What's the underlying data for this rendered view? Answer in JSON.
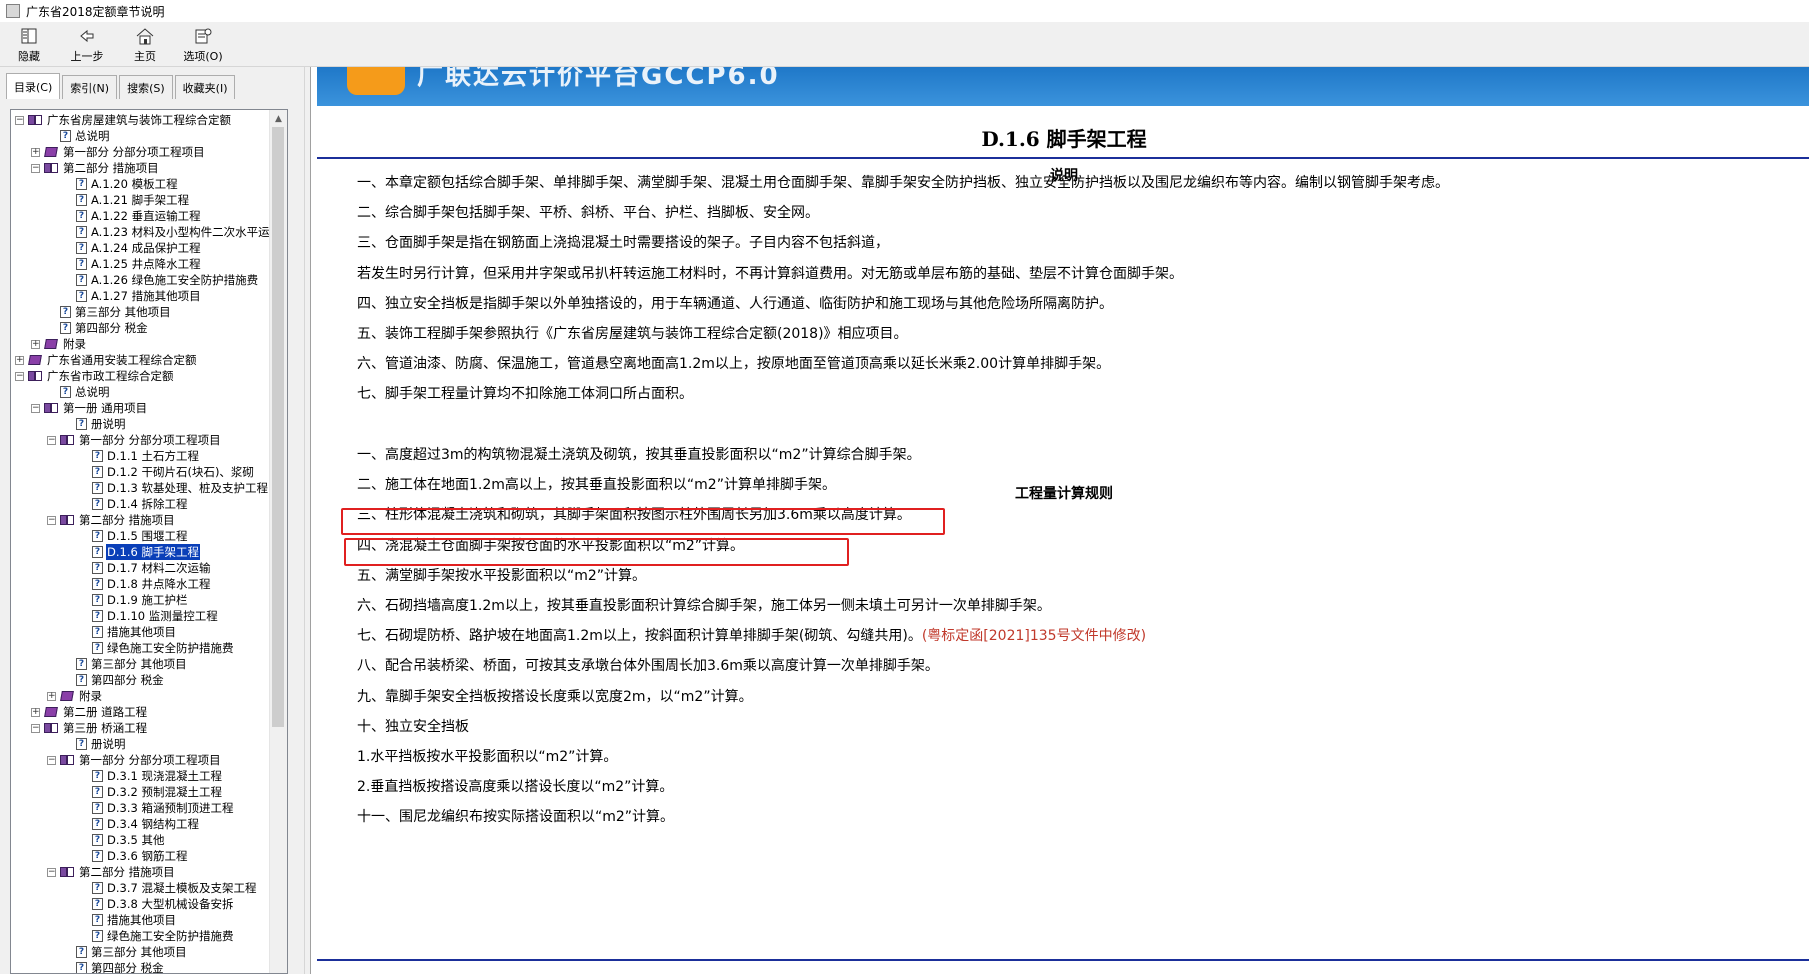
{
  "window": {
    "title": "广东省2018定额章节说明"
  },
  "toolbar": {
    "hide_label": "隐藏",
    "back_label": "上一步",
    "home_label": "主页",
    "options_label": "选项(O)"
  },
  "tabs": {
    "contents": "目录(C)",
    "index": "索引(N)",
    "search": "搜索(S)",
    "favorites": "收藏夹(I)"
  },
  "tree": {
    "items": [
      {
        "label": "广东省房屋建筑与装饰工程综合定额"
      },
      {
        "label": "总说明"
      },
      {
        "label": "第一部分 分部分项工程项目"
      },
      {
        "label": "第二部分 措施项目"
      },
      {
        "label": "A.1.20 模板工程"
      },
      {
        "label": "A.1.21 脚手架工程"
      },
      {
        "label": "A.1.22 垂直运输工程"
      },
      {
        "label": "A.1.23 材料及小型构件二次水平运"
      },
      {
        "label": "A.1.24 成品保护工程"
      },
      {
        "label": "A.1.25 井点降水工程"
      },
      {
        "label": "A.1.26 绿色施工安全防护措施费"
      },
      {
        "label": "A.1.27 措施其他项目"
      },
      {
        "label": "第三部分 其他项目"
      },
      {
        "label": "第四部分 税金"
      },
      {
        "label": "附录"
      },
      {
        "label": "广东省通用安装工程综合定额"
      },
      {
        "label": "广东省市政工程综合定额"
      },
      {
        "label": "总说明"
      },
      {
        "label": "第一册 通用项目"
      },
      {
        "label": "册说明"
      },
      {
        "label": "第一部分 分部分项工程项目"
      },
      {
        "label": "D.1.1 土石方工程"
      },
      {
        "label": "D.1.2 干砌片石(块石)、浆砌"
      },
      {
        "label": "D.1.3 软基处理、桩及支护工程"
      },
      {
        "label": "D.1.4 拆除工程"
      },
      {
        "label": "第二部分 措施项目"
      },
      {
        "label": "D.1.5 围堰工程"
      },
      {
        "label": "D.1.6 脚手架工程"
      },
      {
        "label": "D.1.7 材料二次运输"
      },
      {
        "label": "D.1.8 井点降水工程"
      },
      {
        "label": "D.1.9 施工护栏"
      },
      {
        "label": "D.1.10 监测量控工程"
      },
      {
        "label": "措施其他项目"
      },
      {
        "label": "绿色施工安全防护措施费"
      },
      {
        "label": "第三部分 其他项目"
      },
      {
        "label": "第四部分 税金"
      },
      {
        "label": "附录"
      },
      {
        "label": "第二册 道路工程"
      },
      {
        "label": "第三册 桥涵工程"
      },
      {
        "label": "册说明"
      },
      {
        "label": "第一部分 分部分项工程项目"
      },
      {
        "label": "D.3.1 现浇混凝土工程"
      },
      {
        "label": "D.3.2 预制混凝土工程"
      },
      {
        "label": "D.3.3 箱涵预制顶进工程"
      },
      {
        "label": "D.3.4 钢结构工程"
      },
      {
        "label": "D.3.5 其他"
      },
      {
        "label": "D.3.6 钢筋工程"
      },
      {
        "label": "第二部分 措施项目"
      },
      {
        "label": "D.3.7 混凝土模板及支架工程"
      },
      {
        "label": "D.3.8 大型机械设备安拆"
      },
      {
        "label": "措施其他项目"
      },
      {
        "label": "绿色施工安全防护措施费"
      },
      {
        "label": "第三部分 其他项目"
      },
      {
        "label": "第四部分 税金"
      }
    ]
  },
  "banner": {
    "text": "广联达云计价平台GCCP6.0"
  },
  "doc": {
    "title": "D.1.6 脚手架工程",
    "section1": "说明",
    "lines1": [
      "一、本章定额包括综合脚手架、单排脚手架、满堂脚手架、混凝土用仓面脚手架、靠脚手架安全防护挡板、独立安全防护挡板以及围尼龙编织布等内容。编制以钢管脚手架考虑。",
      "二、综合脚手架包括脚手架、平桥、斜桥、平台、护栏、挡脚板、安全网。",
      "三、仓面脚手架是指在钢筋面上浇捣混凝土时需要搭设的架子。子目内容不包括斜道，",
      "若发生时另行计算，但采用井字架或吊扒杆转运施工材料时，不再计算斜道费用。对无筋或单层布筋的基础、垫层不计算仓面脚手架。",
      "四、独立安全挡板是指脚手架以外单独搭设的，用于车辆通道、人行通道、临街防护和施工现场与其他危险场所隔离防护。",
      "五、装饰工程脚手架参照执行《广东省房屋建筑与装饰工程综合定额(2018)》相应项目。",
      "六、管道油漆、防腐、保温施工，管道悬空离地面高1.2m以上，按原地面至管道顶高乘以延长米乘2.00计算单排脚手架。",
      "七、脚手架工程量计算均不扣除施工体洞口所占面积。"
    ],
    "section2": "工程量计算规则",
    "lines2": [
      "一、高度超过3m的构筑物混凝土浇筑及砌筑，按其垂直投影面积以“m2”计算综合脚手架。",
      "二、施工体在地面1.2m高以上，按其垂直投影面积以“m2”计算单排脚手架。",
      "三、柱形体混凝土浇筑和砌筑，其脚手架面积按图示柱外围周长另加3.6m乘以高度计算。",
      "四、浇混凝土仓面脚手架按仓面的水平投影面积以“m2”计算。",
      "五、满堂脚手架按水平投影面积以“m2”计算。",
      "六、石砌挡墙高度1.2m以上，按其垂直投影面积计算综合脚手架，施工体另一侧未填土可另计一次单排脚手架。",
      "七、石砌堤防桥、路护坡在地面高1.2m以上，按斜面积计算单排脚手架(砌筑、勾缝共用)。",
      "八、配合吊装桥梁、桥面，可按其支承墩台体外围周长加3.6m乘以高度计算一次单排脚手架。",
      "九、靠脚手架安全挡板按搭设长度乘以宽度2m，以“m2”计算。",
      "十、独立安全挡板",
      "1.水平挡板按水平投影面积以“m2”计算。",
      "2.垂直挡板按搭设高度乘以搭设长度以“m2”计算。",
      "十一、围尼龙编织布按实际搭设面积以“m2”计算。"
    ],
    "note_red": "(粤标定函[2021]135号文件中修改)"
  },
  "colors": {
    "highlight_box": "#e02020",
    "rule": "#1b2f9a",
    "note": "#c0392b"
  }
}
